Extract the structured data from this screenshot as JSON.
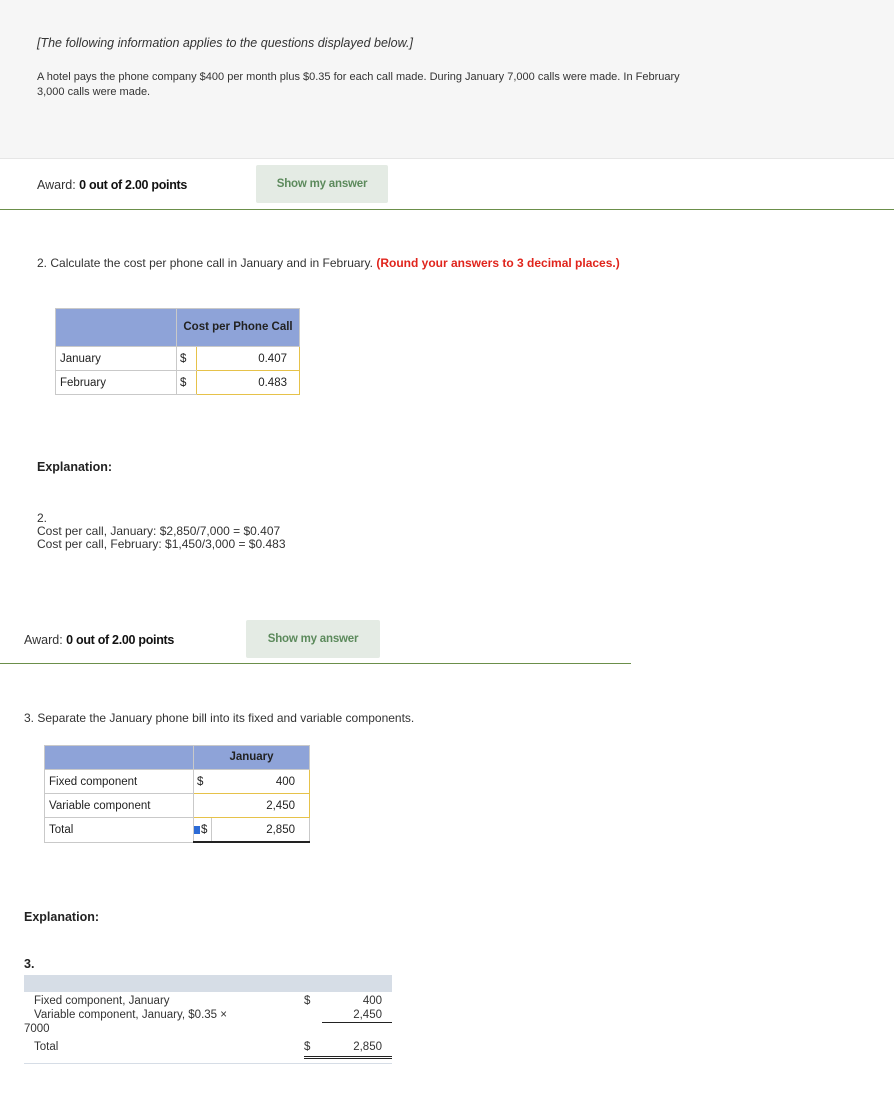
{
  "info": {
    "note": "[The following information applies to the questions displayed below.]",
    "text": "A hotel pays the phone company $400 per month plus $0.35 for each call made. During January 7,000 calls were made. In February 3,000 calls were made."
  },
  "award1": {
    "prefix": "Award: ",
    "score": "0 out of 2.00 points",
    "button": "Show my answer"
  },
  "q2": {
    "number": "2.",
    "text": "Calculate the cost per phone call in January and in February. ",
    "instruction": "(Round your answers to 3 decimal places.)",
    "header": "Cost per Phone Call",
    "rows": [
      {
        "label": "January",
        "currency": "$",
        "value": "0.407"
      },
      {
        "label": "February",
        "currency": "$",
        "value": "0.483"
      }
    ],
    "explanation_title": "Explanation:",
    "explanation_number": "2.",
    "explanation_lines": [
      "Cost per call, January: $2,850/7,000 = $0.407",
      "Cost per call, February: $1,450/3,000 = $0.483"
    ]
  },
  "award2": {
    "prefix": "Award: ",
    "score": "0 out of 2.00 points",
    "button": "Show my answer"
  },
  "q3": {
    "number": "3.",
    "text": "Separate the January phone bill into its fixed and variable components.",
    "header": "January",
    "rows": [
      {
        "label": "Fixed component",
        "currency": "$",
        "value": "400"
      },
      {
        "label": "Variable component",
        "currency": "",
        "value": "2,450"
      },
      {
        "label": "Total",
        "currency": "$",
        "value": "2,850"
      }
    ],
    "explanation_title": "Explanation:",
    "explanation_number": "3.",
    "explanation_rows": [
      {
        "label": "Fixed component, January",
        "currency": "$",
        "value": "400"
      },
      {
        "label": "Variable component, January, $0.35 ×",
        "label_cont": "7000",
        "currency": "",
        "value": "2,450"
      },
      {
        "label": "Total",
        "currency": "$",
        "value": "2,850"
      }
    ]
  },
  "colors": {
    "header_blue": "#8ea3d8",
    "input_border": "#e6c24a",
    "rule_green": "#6b8f4a",
    "red": "#e0241c"
  }
}
